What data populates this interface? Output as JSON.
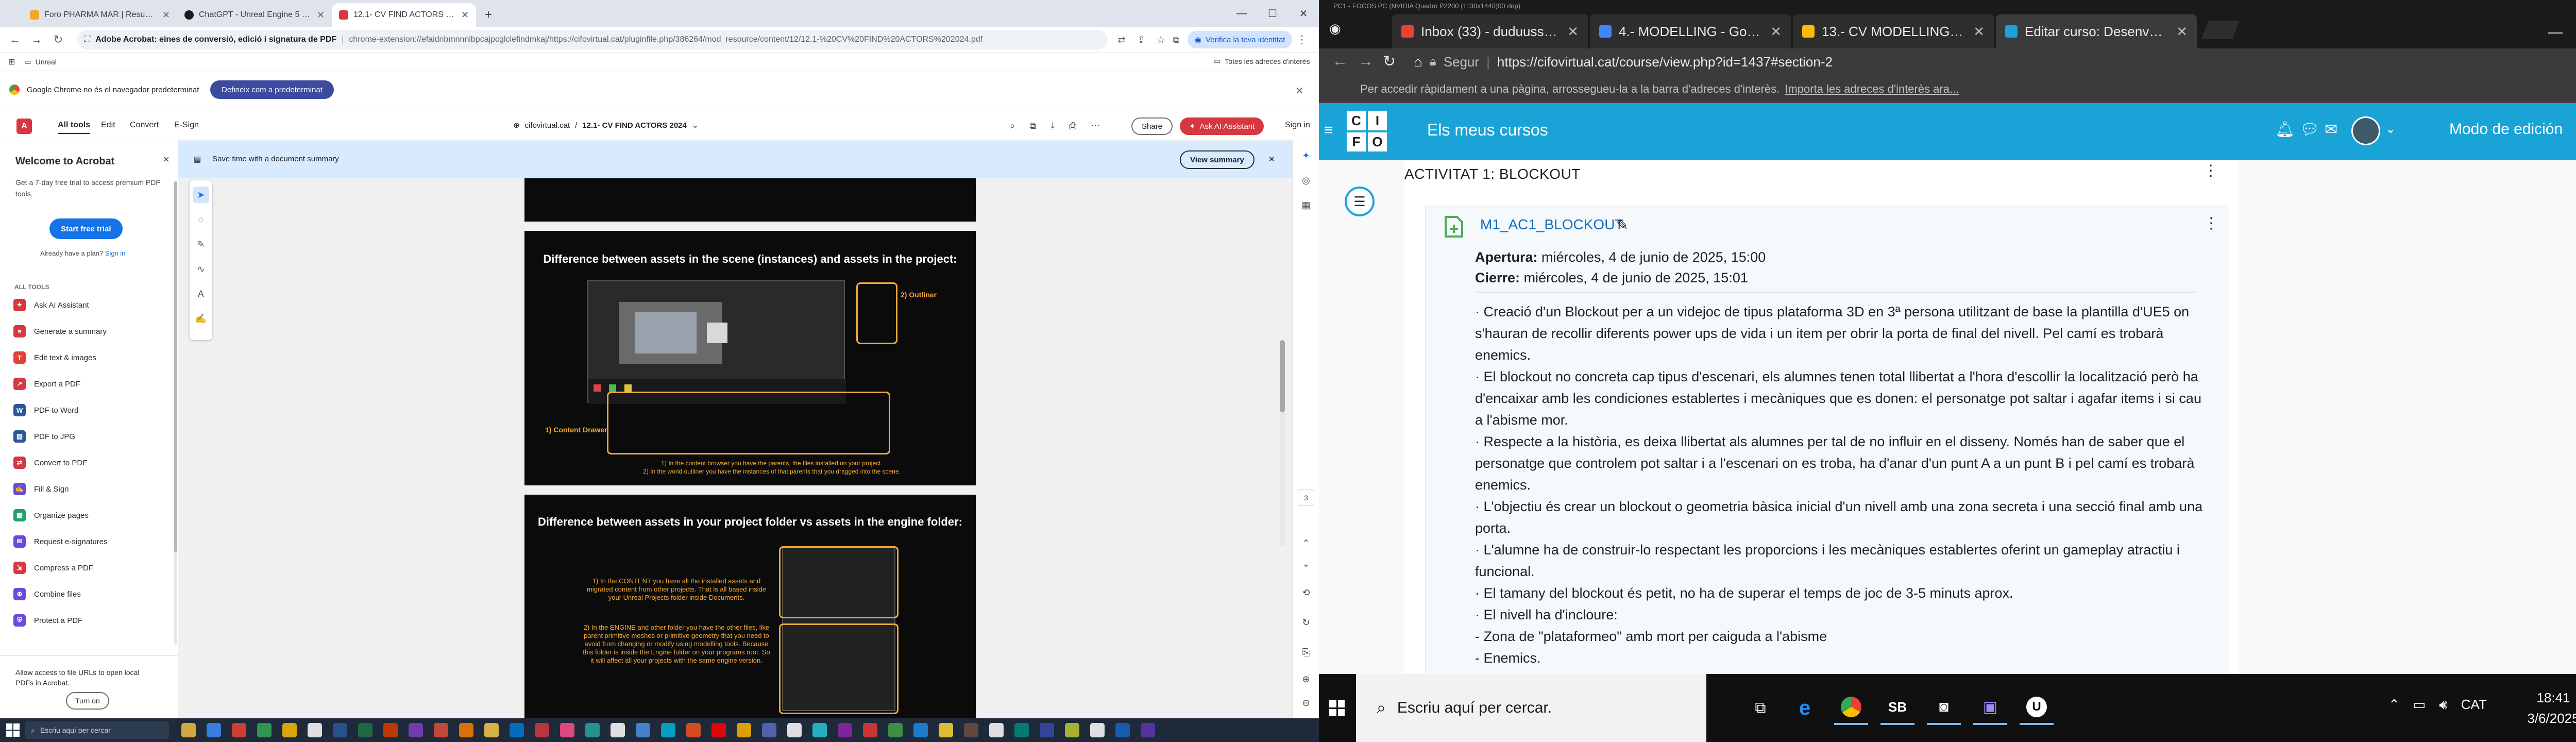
{
  "left": {
    "tabs": [
      {
        "title": "Foro PHARMA MAR | Resumen foro",
        "fav_color": "#f5a623"
      },
      {
        "title": "ChatGPT - Unreal Engine 5 Expert",
        "fav_color": "#1b1b1b"
      },
      {
        "title": "12.1- CV FIND ACTORS 2024.pdf",
        "fav_color": "#d7373f"
      }
    ],
    "new_tab": "+",
    "omnibox": {
      "host": "Adobe Acrobat: eines de conversió, edició i signatura de PDF",
      "url": "chrome-extension://efaidnbmnnnibpcajpcglclefindmkaj/https://cifovirtual.cat/pluginfile.php/386264/mod_resource/content/12/12.1-%20CV%20FIND%20ACTORS%202024.pdf"
    },
    "verify_label": "Verifica la teva identitat",
    "bookmarks": {
      "item": "Unreal",
      "all_label": "Totes les adreces d'interès"
    },
    "infobar": {
      "text": "Google Chrome no és el navegador predeterminat",
      "button": "Defineix com a predeterminat"
    },
    "acrobat": {
      "tabs": [
        "All tools",
        "Edit",
        "Convert",
        "E-Sign"
      ],
      "breadcrumb": "cifovirtual.cat",
      "doc_name": "12.1- CV FIND ACTORS 2024",
      "share": "Share",
      "ai_assistant": "Ask AI Assistant",
      "sign_in": "Sign in",
      "summary_text": "Save time with a document summary",
      "view_summary": "View summary",
      "page_number": "3"
    },
    "sidepanel": {
      "title": "Welcome to Acrobat",
      "body": "Get a 7-day free trial to access premium PDF tools.",
      "free_trial": "Start free trial",
      "already": "Already have a plan?",
      "sign_in": "Sign in",
      "tools_heading": "ALL TOOLS",
      "tools": [
        {
          "label": "Ask AI Assistant",
          "color": "#d7373f"
        },
        {
          "label": "Generate a summary",
          "color": "#d7373f"
        },
        {
          "label": "Edit text & images",
          "color": "#e1403b"
        },
        {
          "label": "Export a PDF",
          "color": "#d7373f"
        },
        {
          "label": "PDF to Word",
          "color": "#2b579a"
        },
        {
          "label": "PDF to JPG",
          "color": "#2b579a"
        },
        {
          "label": "Convert to PDF",
          "color": "#d7373f"
        },
        {
          "label": "Fill & Sign",
          "color": "#6c4bd8"
        },
        {
          "label": "Organize pages",
          "color": "#22a06b"
        },
        {
          "label": "Request e-signatures",
          "color": "#6c4bd8"
        },
        {
          "label": "Compress a PDF",
          "color": "#d7373f"
        },
        {
          "label": "Combine files",
          "color": "#6c4bd8"
        },
        {
          "label": "Protect a PDF",
          "color": "#6c4bd8"
        }
      ],
      "footer": "Allow access to file URLs to open local PDFs in Acrobat.",
      "turn_on": "Turn on"
    },
    "pages": [
      {
        "title": "Difference between assets in the scene (instances) and assets in the project:",
        "outliner": "2) Outliner",
        "content_drawer": "1) Content Drawer",
        "caption1": "1) In the content browser you have the parents, the files installed on your project.",
        "caption2": "2) In the world outliner you have the instances of that parents that you dragged into the scene."
      },
      {
        "title": "Difference between assets in your project folder vs assets in the engine folder:",
        "para1": "1) In the CONTENT you have all the installed assets and migrated content from other projects. That is all based inside your Unreal Projects folder inside Documents.",
        "para2": "2) In the ENGINE and other folder you have the other files, like parent primitive meshes or primitive geometry that you need to avoid from changing or modify using modelling tools. Because this folder is inside the Engine folder on your programs root. So it will affect all your projects with the same engine version."
      }
    ],
    "taskbar": {
      "search": "Escriu aquí per cercar"
    }
  },
  "right": {
    "top_title": "PC1 - FOCOS PC (NVIDIA Quadro P2200 (1130x1440)00 dep)",
    "tabs": [
      {
        "title": "Inbox (33) - duduusstar@...",
        "fav_color": "#ea4335"
      },
      {
        "title": "4.- MODELLING - Google...",
        "fav_color": "#4285f4"
      },
      {
        "title": "13.- CV MODELLING 202...",
        "fav_color": "#fbbc04"
      },
      {
        "title": "Editar curso: Desenvolup...",
        "fav_color": "#1aa3d6"
      }
    ],
    "omnibox": {
      "secure": "Segur",
      "url": "https://cifovirtual.cat/course/view.php?id=1437#section-2"
    },
    "hint": "Per accedir ràpidament a una pàgina, arrossegueu-la a la barra d'adreces d'interès.",
    "hint_link": "Importa les adreces d'interès ara...",
    "moodle": {
      "logo": [
        "C",
        "I",
        "F",
        "O"
      ],
      "my_courses": "Els meus cursos",
      "edit_mode": "Modo de edición",
      "section_title": "ACTIVITAT 1: BLOCKOUT",
      "activity_name": "M1_AC1_BLOCKOUT",
      "open_label": "Apertura:",
      "open_date": "miércoles, 4 de junio de 2025, 15:00",
      "close_label": "Cierre:",
      "close_date": "miércoles, 4 de junio de 2025, 15:01",
      "description": [
        "· Creació d'un Blockout per a un videjoc de tipus plataforma 3D en 3ª persona utilitzant de base la plantilla d'UE5 on s'hauran de recollir diferents power ups de vida i un item per obrir la porta de final del nivell. Pel camí es trobarà enemics.",
        "· El blockout no concreta cap tipus d'escenari, els alumnes tenen total llibertat a l'hora d'escollir la localització però ha d'encaixar amb les condiciones establertes i mecàniques que es donen: el personatge pot saltar i agafar items i si cau a l'abisme mor.",
        "· Respecte a la història, es deixa llibertat als alumnes per tal de no influir en el disseny. Només han de saber que el personatge que controlem pot saltar i a l'escenari on es troba, ha d'anar d'un punt A a un punt B i pel camí es trobarà enemics.",
        "· L'objectiu és crear un blockout o geometria bàsica inicial d'un nivell amb una zona secreta i una secció final amb una porta.",
        "· L'alumne ha de construir-lo respectant les proporcions i les mecàniques establertes oferint un gameplay atractiu i funcional.",
        "· El tamany del blockout és petit, no ha de superar el temps de joc de 3-5 minuts aprox.",
        "· El nivell ha d'incloure:",
        "- Zona de \"plataformeo\" amb mort per caiguda a l'abisme",
        "- Enemics."
      ]
    },
    "taskbar": {
      "search": "Escriu aquí per cercar.",
      "lang": "CAT",
      "time": "18:41",
      "date": "3/6/2025"
    }
  }
}
